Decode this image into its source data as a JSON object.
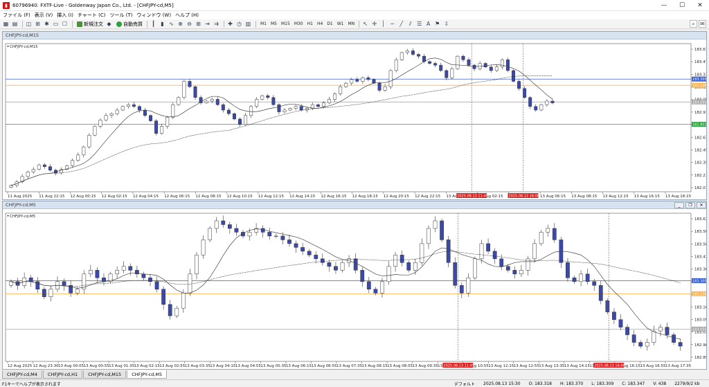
{
  "window": {
    "title": "60796940: FXTF-Live - Goldenway Japan Co., Ltd. - [CHFJPY-cd,M5]",
    "app_icon": "mt4-app-icon"
  },
  "menu": [
    "ファイル (F)",
    "表示 (V)",
    "挿入 (I)",
    "チャート (C)",
    "ツール (T)",
    "ウィンドウ (W)",
    "ヘルプ (H)"
  ],
  "toolbar": {
    "new_order_label": "新規注文",
    "auto_trade_label": "自動売買",
    "timeframes": [
      "M1",
      "M5",
      "M15",
      "M30",
      "H1",
      "H4",
      "D1",
      "W1",
      "MN"
    ],
    "text_tool": "A"
  },
  "charts": [
    {
      "window_caption": "CHFJPY-cd,M15",
      "label": "CHFJPY-cd,M15",
      "price_labels": [
        "183.610",
        "183.470",
        "183.330",
        "183.190",
        "183.050",
        "182.910",
        "182.770",
        "182.630",
        "182.490",
        "182.350",
        "182.210",
        "182.070"
      ],
      "time_labels": [
        "11 Aug 2025",
        "11 Aug 22:15",
        "12 Aug 00:15",
        "12 Aug 02:15",
        "12 Aug 04:15",
        "12 Aug 06:15",
        "12 Aug 08:15",
        "12 Aug 10:15",
        "12 Aug 12:15",
        "12 Aug 14:15",
        "12 Aug 16:15",
        "12 Aug 18:15",
        "12 Aug 20:15",
        "12 Aug 22:15",
        "13 Aug 00:15",
        "13 Aug 02:15",
        "13 Aug 04:15",
        "13 Aug 06:15",
        "13 Aug 08:15",
        "13 Aug 12:15",
        "13 Aug 16:15",
        "13 Aug 18:15"
      ],
      "hlines": [
        {
          "price": 183.305,
          "color": "#3a5fcd",
          "label": "183.305"
        },
        {
          "price": 183.236,
          "color": "#ffb347",
          "label": "183.236"
        },
        {
          "price": 183.05,
          "color": "#aaaaaa",
          "label": "183.050"
        },
        {
          "price": 182.801,
          "color": "#2e9e3e",
          "label": "182.801"
        }
      ],
      "vlines": [
        {
          "label": "2025.08.13 11:45",
          "color": "#d22"
        },
        {
          "label": "2025.08.13 16:00",
          "color": "#d22"
        }
      ]
    },
    {
      "window_caption": "CHFJPY-cd,M5",
      "label": "CHFJPY-cd,M5",
      "price_labels": [
        "183.635",
        "183.565",
        "183.500",
        "183.430",
        "183.365",
        "183.295",
        "183.230",
        "183.160",
        "183.090",
        "183.025",
        "182.960",
        "182.895"
      ],
      "time_labels": [
        "12 Aug 2025",
        "12 Aug 23:30",
        "13 Aug 00:05",
        "13 Aug 00:55",
        "13 Aug 01:35",
        "13 Aug 02:15",
        "13 Aug 02:55",
        "13 Aug 03:35",
        "13 Aug 04:15",
        "13 Aug 04:55",
        "13 Aug 05:35",
        "13 Aug 06:15",
        "13 Aug 06:55",
        "13 Aug 07:35",
        "13 Aug 08:15",
        "13 Aug 08:55",
        "13 Aug 09:35",
        "13 Aug 10:15",
        "13 Aug 10:55",
        "13 Aug 12:15",
        "13 Aug 12:55",
        "13 Aug 13:35",
        "13 Aug 14:15",
        "13 Aug 14:55",
        "13 Aug 16:15",
        "13 Aug 16:55",
        "13 Aug 17:35"
      ],
      "hlines": [
        {
          "price": 183.305,
          "color": "#3a5fcd",
          "label": "183.305"
        },
        {
          "price": 183.236,
          "color": "#ffb347",
          "label": "183.236"
        },
        {
          "price": 183.05,
          "color": "#aaaaaa",
          "label": "183.050"
        }
      ],
      "vlines": [
        {
          "label": "2025.08.13 11:45",
          "color": "#d22"
        },
        {
          "label": "2025.08.13 16:00",
          "color": "#d22"
        }
      ]
    }
  ],
  "chart_data": [
    {
      "type": "candlestick",
      "symbol": "CHFJPY-cd",
      "timeframe": "M15",
      "ylim": [
        182.05,
        183.7
      ],
      "grid": false,
      "close_series": [
        182.12,
        182.16,
        182.22,
        182.27,
        182.3,
        182.35,
        182.33,
        182.29,
        182.26,
        182.3,
        182.34,
        182.4,
        182.46,
        182.55,
        182.68,
        182.78,
        182.85,
        182.9,
        182.92,
        182.96,
        183.0,
        183.02,
        183.0,
        182.96,
        182.9,
        182.84,
        182.7,
        182.78,
        182.88,
        183.02,
        183.1,
        183.28,
        183.22,
        183.1,
        183.04,
        183.06,
        183.08,
        183.02,
        182.96,
        182.92,
        182.86,
        182.8,
        182.9,
        183.0,
        183.08,
        183.12,
        183.1,
        183.02,
        182.94,
        182.96,
        182.98,
        183.0,
        182.96,
        182.98,
        183.02,
        183.0,
        183.04,
        183.08,
        183.14,
        183.22,
        183.26,
        183.3,
        183.28,
        183.32,
        183.3,
        183.26,
        183.18,
        183.22,
        183.4,
        183.52,
        183.6,
        183.62,
        183.58,
        183.56,
        183.5,
        183.48,
        183.46,
        183.4,
        183.32,
        183.42,
        183.56,
        183.52,
        183.46,
        183.42,
        183.48,
        183.44,
        183.4,
        183.44,
        183.52,
        183.4,
        183.28,
        183.2,
        183.1,
        183.0,
        182.96,
        183.02,
        183.06,
        183.04
      ]
    },
    {
      "type": "candlestick",
      "symbol": "CHFJPY-cd",
      "timeframe": "M5",
      "ylim": [
        182.88,
        183.66
      ],
      "grid": false,
      "close_series": [
        183.3,
        183.28,
        183.32,
        183.3,
        183.26,
        183.22,
        183.26,
        183.3,
        183.28,
        183.24,
        183.26,
        183.34,
        183.36,
        183.32,
        183.3,
        183.34,
        183.36,
        183.38,
        183.36,
        183.34,
        183.32,
        183.3,
        183.26,
        183.18,
        183.12,
        183.16,
        183.24,
        183.34,
        183.44,
        183.52,
        183.58,
        183.62,
        183.6,
        183.58,
        183.56,
        183.54,
        183.56,
        183.58,
        183.56,
        183.54,
        183.54,
        183.52,
        183.5,
        183.48,
        183.46,
        183.44,
        183.42,
        183.4,
        183.38,
        183.36,
        183.4,
        183.42,
        183.36,
        183.3,
        183.26,
        183.24,
        183.3,
        183.38,
        183.44,
        183.4,
        183.36,
        183.4,
        183.5,
        183.58,
        183.62,
        183.52,
        183.4,
        183.28,
        183.24,
        183.32,
        183.42,
        183.5,
        183.46,
        183.42,
        183.38,
        183.36,
        183.34,
        183.36,
        183.42,
        183.5,
        183.56,
        183.58,
        183.52,
        183.4,
        183.32,
        183.3,
        183.34,
        183.3,
        183.28,
        183.2,
        183.14,
        183.1,
        183.06,
        183.02,
        182.98,
        182.96,
        182.98,
        183.04,
        183.06,
        183.02,
        182.98,
        182.96
      ]
    }
  ],
  "tabs": [
    "CHFJPY-cd,M4",
    "CHFJPY-cd,H1",
    "CHFJPY-cd,M15",
    "CHFJPY-cd,M5"
  ],
  "active_tab": 3,
  "status": {
    "help": "F1キーでヘルプが表示されます",
    "profile": "デフォルト",
    "datetime": "2025.08.13 15:30",
    "open": "O: 183.318",
    "high": "H: 183.370",
    "low": "L: 183.309",
    "close": "C: 183.347",
    "volume": "V: 438",
    "traffic": "2279/9/2 kb"
  },
  "colors": {
    "bull": "#ffffff",
    "bear": "#3b4aa8",
    "wick": "#333333",
    "ma_fast": "#444444",
    "ma_slow": "#222222",
    "vline_badge": "#e11d1d"
  }
}
